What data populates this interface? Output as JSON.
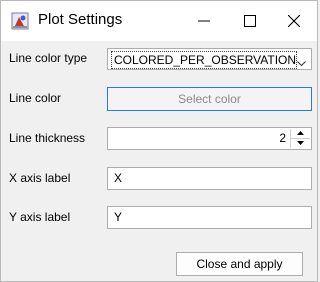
{
  "window": {
    "title": "Plot Settings",
    "app_icon": "plot-app-icon",
    "controls": {
      "minimize_icon": "minimize-icon",
      "maximize_icon": "maximize-icon",
      "close_icon": "close-icon"
    }
  },
  "form": {
    "line_color_type": {
      "label": "Line color type",
      "value": "COLORED_PER_OBSERVATION",
      "icon": "chevron-down-icon"
    },
    "line_color": {
      "label": "Line color",
      "button_label": "Select color"
    },
    "line_thickness": {
      "label": "Line thickness",
      "value": "2"
    },
    "x_axis_label": {
      "label": "X axis label",
      "value": "X"
    },
    "y_axis_label": {
      "label": "Y axis label",
      "value": "Y"
    }
  },
  "footer": {
    "close_apply_label": "Close and apply"
  },
  "colors": {
    "accent_border": "#2a7bd3",
    "window_bg": "#f0f0f0",
    "titlebar_bg": "#ffffff"
  }
}
